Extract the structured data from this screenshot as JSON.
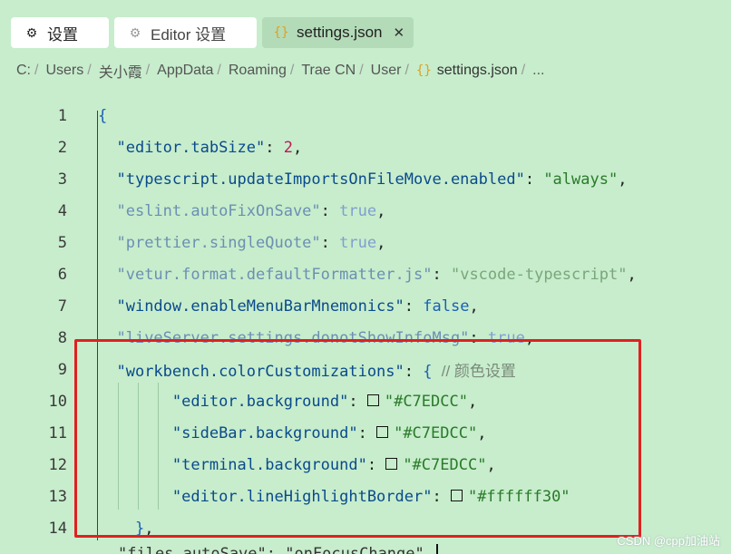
{
  "tabs": [
    {
      "label": "设置",
      "icon": "gear-icon",
      "active": false
    },
    {
      "label": "Editor 设置",
      "icon": "gear-icon",
      "active": false
    },
    {
      "label": "settings.json",
      "icon": "json-braces-icon",
      "active": true,
      "close_glyph": "✕"
    }
  ],
  "breadcrumb": [
    "C:",
    "Users",
    "关小霞",
    "AppData",
    "Roaming",
    "Trae CN",
    "User",
    "settings.json",
    "..."
  ],
  "breadcrumb_sep": "/",
  "editor": {
    "lines": [
      {
        "n": "1",
        "open": "{"
      },
      {
        "n": "2",
        "key": "\"editor.tabSize\"",
        "colon": ": ",
        "num": "2",
        "tail": ","
      },
      {
        "n": "3",
        "key": "\"typescript.updateImportsOnFileMove.enabled\"",
        "colon": ": ",
        "str": "\"always\"",
        "tail": ","
      },
      {
        "n": "4",
        "key": "\"eslint.autoFixOnSave\"",
        "colon": ": ",
        "bool": "true",
        "tail": ","
      },
      {
        "n": "5",
        "key": "\"prettier.singleQuote\"",
        "colon": ": ",
        "bool": "true",
        "tail": ","
      },
      {
        "n": "6",
        "key": "\"vetur.format.defaultFormatter.js\"",
        "colon": ": ",
        "str": "\"vscode-typescript\"",
        "tail": ","
      },
      {
        "n": "7",
        "key": "\"window.enableMenuBarMnemonics\"",
        "colon": ": ",
        "bool": "false",
        "tail": ","
      },
      {
        "n": "8",
        "key": "\"liveServer.settings.donotShowInfoMsg\"",
        "colon": ": ",
        "bool": "true",
        "tail": ","
      },
      {
        "n": "9",
        "key": "\"workbench.colorCustomizations\"",
        "colon": ": ",
        "open": "{",
        "comment": "// 颜色设置"
      },
      {
        "n": "10",
        "key": "\"editor.background\"",
        "colon": ": ",
        "str": "\"#C7EDCC\"",
        "tail": ",",
        "swatch": "#C7EDCC"
      },
      {
        "n": "11",
        "key": "\"sideBar.background\"",
        "colon": ": ",
        "str": "\"#C7EDCC\"",
        "tail": ",",
        "swatch": "#C7EDCC"
      },
      {
        "n": "12",
        "key": "\"terminal.background\"",
        "colon": ": ",
        "str": "\"#C7EDCC\"",
        "tail": ",",
        "swatch": "#C7EDCC"
      },
      {
        "n": "13",
        "key": "\"editor.lineHighlightBorder\"",
        "colon": ": ",
        "str": "\"#ffffff30\"",
        "tail": "",
        "swatch": "#ffffff30"
      },
      {
        "n": "14",
        "close": "}",
        "tail": ","
      }
    ],
    "partial_line_text": "\"files.autoSave\": \"onFocusChange\""
  },
  "watermark": "CSDN @cpp加油站",
  "colors": {
    "background": "#C7EDCC",
    "highlight_box": "#e02020",
    "json_key": "#0a4a8c",
    "json_string": "#2a7a2a",
    "json_number": "#c0185a",
    "json_bool": "#1a5fb4"
  }
}
